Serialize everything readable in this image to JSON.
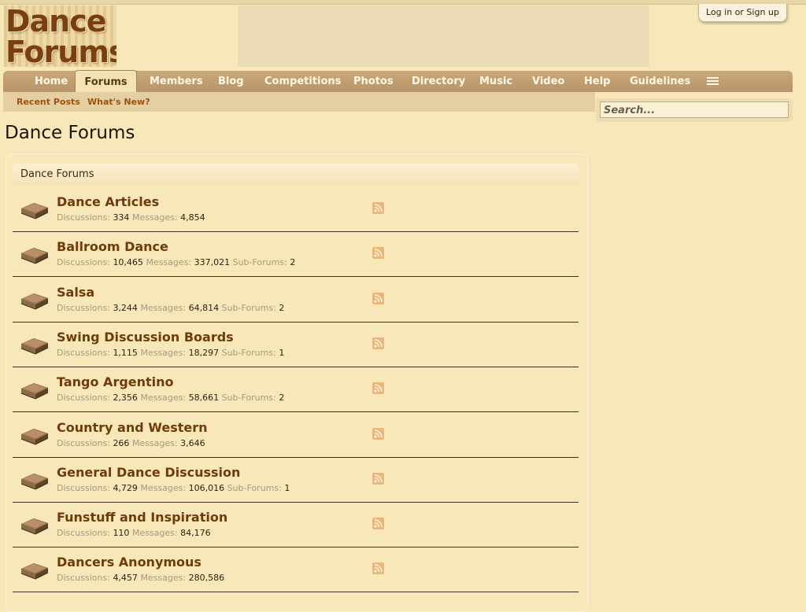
{
  "logo": {
    "line1": "Dance",
    "line2": "Forums"
  },
  "login": {
    "label": "Log in or Sign up"
  },
  "nav": {
    "tabs": [
      {
        "label": "Home",
        "id": "home"
      },
      {
        "label": "Forums",
        "id": "forums",
        "active": true
      },
      {
        "label": "Members",
        "id": "members"
      },
      {
        "label": "Blog",
        "id": "blog"
      },
      {
        "label": "Competitions",
        "id": "competitions"
      },
      {
        "label": "Photos",
        "id": "photos"
      },
      {
        "label": "Directory",
        "id": "directory"
      },
      {
        "label": "Music",
        "id": "music"
      },
      {
        "label": "Video",
        "id": "video"
      },
      {
        "label": "Help",
        "id": "help"
      },
      {
        "label": "Guidelines",
        "id": "guidelines"
      }
    ],
    "menu_icon": "hamburger-icon"
  },
  "subnav": {
    "links": [
      {
        "label": "Recent Posts"
      },
      {
        "label": "What's New?"
      }
    ]
  },
  "search": {
    "placeholder": "Search..."
  },
  "page": {
    "title": "Dance Forums"
  },
  "category": {
    "title": "Dance Forums"
  },
  "stat_labels": {
    "discussions": "Discussions:",
    "messages": "Messages:",
    "subforums": "Sub-Forums:"
  },
  "forums": [
    {
      "title": "Dance Articles",
      "discussions": "334",
      "messages": "4,854",
      "subforums": ""
    },
    {
      "title": "Ballroom Dance",
      "discussions": "10,465",
      "messages": "337,021",
      "subforums": "2"
    },
    {
      "title": "Salsa",
      "discussions": "3,244",
      "messages": "64,814",
      "subforums": "2"
    },
    {
      "title": "Swing Discussion Boards",
      "discussions": "1,115",
      "messages": "18,297",
      "subforums": "1"
    },
    {
      "title": "Tango Argentino",
      "discussions": "2,356",
      "messages": "58,661",
      "subforums": "2"
    },
    {
      "title": "Country and Western",
      "discussions": "266",
      "messages": "3,646",
      "subforums": ""
    },
    {
      "title": "General Dance Discussion",
      "discussions": "4,729",
      "messages": "106,016",
      "subforums": "1"
    },
    {
      "title": "Funstuff and Inspiration",
      "discussions": "110",
      "messages": "84,176",
      "subforums": ""
    },
    {
      "title": "Dancers Anonymous",
      "discussions": "4,457",
      "messages": "280,586",
      "subforums": ""
    }
  ],
  "colors": {
    "background": "#f7e7b9",
    "navbar": "#b8956a",
    "link": "#6e3b09",
    "subnav_link": "#a0500f"
  }
}
